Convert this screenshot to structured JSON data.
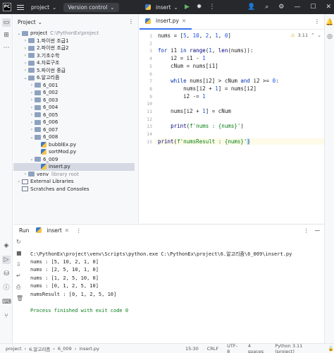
{
  "titlebar": {
    "project_label": "project",
    "vcs_label": "Version control",
    "run_config": "insert"
  },
  "project_panel": {
    "title": "Project",
    "items": [
      {
        "label": "project",
        "hint": "C:\\PythonEx\\project",
        "level": 0,
        "type": "folder",
        "open": true
      },
      {
        "label": "1.파이썬 조급1",
        "level": 1,
        "type": "folder",
        "open": false
      },
      {
        "label": "2.파이썬 조급2",
        "level": 1,
        "type": "folder",
        "open": false
      },
      {
        "label": "3.기초수학",
        "level": 1,
        "type": "folder",
        "open": false
      },
      {
        "label": "4.자료구조",
        "level": 1,
        "type": "folder",
        "open": false
      },
      {
        "label": "5.파이썬 중급",
        "level": 1,
        "type": "folder",
        "open": false
      },
      {
        "label": "6.알고리즘",
        "level": 1,
        "type": "folder",
        "open": true
      },
      {
        "label": "6_001",
        "level": 2,
        "type": "folder",
        "open": false
      },
      {
        "label": "6_002",
        "level": 2,
        "type": "folder",
        "open": false
      },
      {
        "label": "6_003",
        "level": 2,
        "type": "folder",
        "open": false
      },
      {
        "label": "6_004",
        "level": 2,
        "type": "folder",
        "open": false
      },
      {
        "label": "6_005",
        "level": 2,
        "type": "folder",
        "open": false
      },
      {
        "label": "6_006",
        "level": 2,
        "type": "folder",
        "open": false
      },
      {
        "label": "6_007",
        "level": 2,
        "type": "folder",
        "open": false
      },
      {
        "label": "6_008",
        "level": 2,
        "type": "folder",
        "open": true
      },
      {
        "label": "bubblEx.py",
        "level": 3,
        "type": "py"
      },
      {
        "label": "sortMod.py",
        "level": 3,
        "type": "py"
      },
      {
        "label": "6_009",
        "level": 2,
        "type": "folder",
        "open": true
      },
      {
        "label": "insert.py",
        "level": 3,
        "type": "py",
        "selected": true
      },
      {
        "label": "venv",
        "hint": "library root",
        "level": 1,
        "type": "folder",
        "open": false
      },
      {
        "label": "External Libraries",
        "level": 0,
        "type": "lib",
        "open": false
      },
      {
        "label": "Scratches and Consoles",
        "level": 0,
        "type": "lib"
      }
    ]
  },
  "editor": {
    "tab_label": "insert.py",
    "inspection": "3.11",
    "lines": [
      {
        "n": "1",
        "html": "nums = [<span class='num'>5</span>, <span class='num'>10</span>, <span class='num'>2</span>, <span class='num'>1</span>, <span class='num'>0</span>]"
      },
      {
        "n": "2",
        "html": ""
      },
      {
        "n": "3",
        "html": "<span class='kw'>for</span> i1 <span class='kw'>in</span> <span class='fn'>range</span>(<span class='num'>1</span>, <span class='fn'>len</span>(nums)):"
      },
      {
        "n": "4",
        "html": "    i2 = i1 - <span class='num'>1</span>"
      },
      {
        "n": "5",
        "html": "    cNum = nums[i1]"
      },
      {
        "n": "6",
        "html": ""
      },
      {
        "n": "7",
        "html": "    <span class='kw'>while</span> nums[i2] &gt; cNum <span class='kw'>and</span> i2 &gt;= <span class='num'>0</span>:"
      },
      {
        "n": "8",
        "html": "        nums[i2 + <span class='num'>1</span>] = nums[i2]"
      },
      {
        "n": "9",
        "html": "        i2 -= <span class='num'>1</span>"
      },
      {
        "n": "10",
        "html": ""
      },
      {
        "n": "11",
        "html": "    nums[i2 + <span class='num'>1</span>] = cNum"
      },
      {
        "n": "12",
        "html": ""
      },
      {
        "n": "13",
        "html": "    <span class='fn'>print</span>(<span class='str'>f'nums : {nums}'</span>)"
      },
      {
        "n": "14",
        "html": ""
      },
      {
        "n": "15",
        "html": "<span class='fn'>print</span>(<span class='str'>f'numsResult : {nums}'</span><span class='brace'>)</span>"
      }
    ]
  },
  "run_panel": {
    "title": "Run",
    "tab_label": "insert",
    "output": [
      "C:\\PythonEx\\project\\venv\\Scripts\\python.exe C:\\PythonEx\\project\\6.알고리즘\\6_009\\insert.py",
      "nums : [5, 10, 2, 1, 0]",
      "nums : [2, 5, 10, 1, 0]",
      "nums : [1, 2, 5, 10, 0]",
      "nums : [0, 1, 2, 5, 10]",
      "numsResult : [0, 1, 2, 5, 10]",
      "",
      "Process finished with exit code 0"
    ]
  },
  "statusbar": {
    "crumbs": [
      "project",
      "6.알고리즘",
      "6_009",
      "insert.py"
    ],
    "position": "15:30",
    "line_sep": "CRLF",
    "encoding": "UTF-8",
    "indent": "4 spaces",
    "interpreter": "Python 3.11 (project)"
  }
}
